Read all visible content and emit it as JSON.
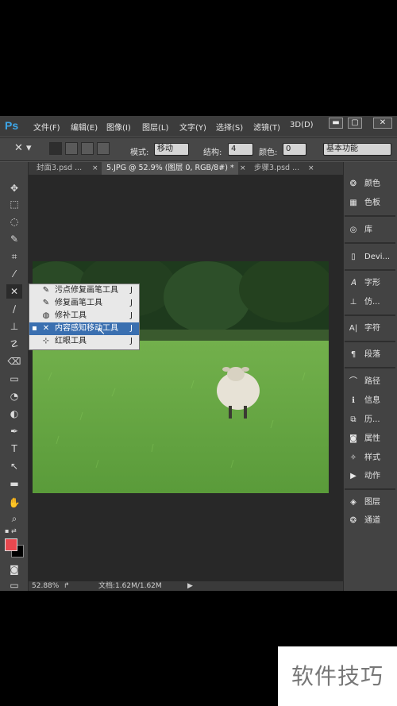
{
  "app": {
    "logo": "Ps"
  },
  "menu": [
    "文件(F)",
    "编辑(E)",
    "图像(I)",
    "图层(L)",
    "文字(Y)",
    "选择(S)",
    "滤镜(T)",
    "3D(D)"
  ],
  "window_controls": {
    "minimize": "▬",
    "maximize": "▢",
    "close": "✕"
  },
  "options": {
    "mode_label": "模式:",
    "mode_value": "移动",
    "structure_label": "结构:",
    "structure_value": "4",
    "color_label": "颜色:",
    "color_value": "0",
    "workspace": "基本功能"
  },
  "tabs": [
    {
      "label": "封面3.psd ...",
      "active": false
    },
    {
      "label": "5.JPG @ 52.9% (图层 0, RGB/8#) *",
      "active": true
    },
    {
      "label": "步骤3.psd ...",
      "active": false
    }
  ],
  "status": {
    "zoom": "52.88%",
    "doc": "文档:1.62M/1.62M"
  },
  "flyout": [
    {
      "label": "污点修复画笔工具",
      "key": "J",
      "icon": "spot-healing-brush-icon",
      "selected": false
    },
    {
      "label": "修复画笔工具",
      "key": "J",
      "icon": "healing-brush-icon",
      "selected": false
    },
    {
      "label": "修补工具",
      "key": "J",
      "icon": "patch-icon",
      "selected": false
    },
    {
      "label": "内容感知移动工具",
      "key": "J",
      "icon": "content-aware-move-icon",
      "selected": true
    },
    {
      "label": "红眼工具",
      "key": "J",
      "icon": "red-eye-icon",
      "selected": false
    }
  ],
  "panels": [
    {
      "label": "颜色",
      "icon": "color-icon"
    },
    {
      "label": "色板",
      "icon": "swatches-icon"
    },
    {
      "label": "库",
      "icon": "libraries-icon"
    },
    {
      "label": "Devi...",
      "icon": "device-preview-icon"
    },
    {
      "label": "字形",
      "icon": "glyphs-icon"
    },
    {
      "label": "仿...",
      "icon": "clone-source-icon"
    },
    {
      "label": "字符",
      "icon": "character-icon"
    },
    {
      "label": "段落",
      "icon": "paragraph-icon"
    },
    {
      "label": "路径",
      "icon": "paths-icon"
    },
    {
      "label": "信息",
      "icon": "info-icon"
    },
    {
      "label": "历...",
      "icon": "history-icon"
    },
    {
      "label": "属性",
      "icon": "properties-icon"
    },
    {
      "label": "样式",
      "icon": "styles-icon"
    },
    {
      "label": "动作",
      "icon": "actions-icon"
    },
    {
      "label": "图层",
      "icon": "layers-icon"
    },
    {
      "label": "通道",
      "icon": "channels-icon"
    }
  ],
  "colors": {
    "foreground": "#e8484f",
    "background": "#000000",
    "accent": "#3a6fb0"
  },
  "watermark": "软件技巧"
}
